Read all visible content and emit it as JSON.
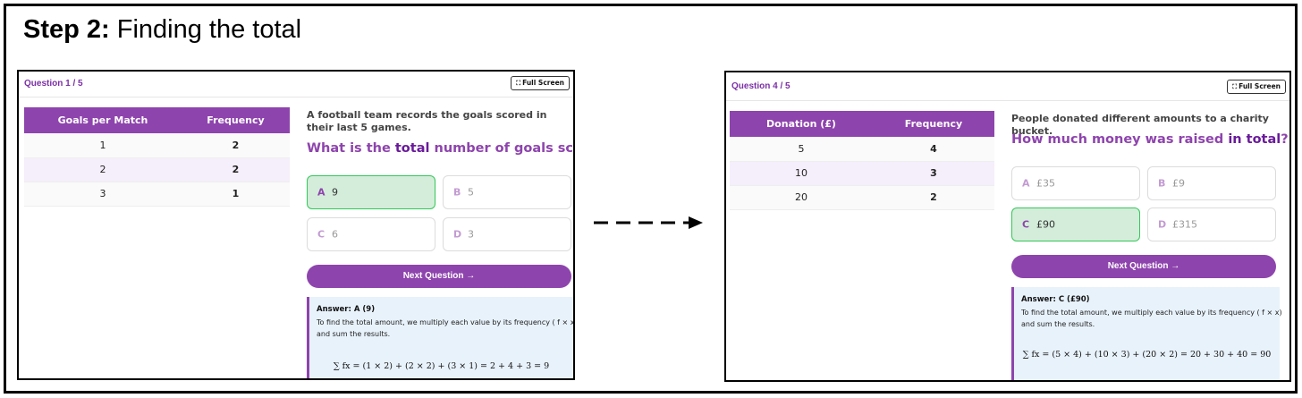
{
  "step": {
    "label": "Step 2:",
    "title": "Finding the total"
  },
  "fullscreen_label": "Full Screen",
  "next_label": "Next Question →",
  "panels": [
    {
      "counter": "Question 1 / 5",
      "columns": [
        "Goals per Match",
        "Frequency"
      ],
      "rows": [
        [
          "1",
          "2"
        ],
        [
          "2",
          "2"
        ],
        [
          "3",
          "1"
        ]
      ],
      "context": "A football team records the goals scored in their last 5 games.",
      "question_pre": "What is the ",
      "question_emph": "total",
      "question_post": " number of goals scored?",
      "options": [
        {
          "letter": "A",
          "text": "9",
          "state": "correct"
        },
        {
          "letter": "B",
          "text": "5",
          "state": "default"
        },
        {
          "letter": "C",
          "text": "6",
          "state": "default"
        },
        {
          "letter": "D",
          "text": "3",
          "state": "default"
        }
      ],
      "answer_title": "Answer: A (9)",
      "answer_explanation": "To find the total amount, we multiply each value by its frequency ( f × x) and sum the results.",
      "formula": "∑ fx = (1 × 2) + (2 × 2) + (3 × 1) = 2 + 4 + 3 = 9"
    },
    {
      "counter": "Question 4 / 5",
      "columns": [
        "Donation (£)",
        "Frequency"
      ],
      "rows": [
        [
          "5",
          "4"
        ],
        [
          "10",
          "3"
        ],
        [
          "20",
          "2"
        ]
      ],
      "context": "People donated different amounts to a charity bucket.",
      "question_pre": "How much money was raised ",
      "question_emph": "in total",
      "question_post": "?",
      "options": [
        {
          "letter": "A",
          "text": "£35",
          "state": "default"
        },
        {
          "letter": "B",
          "text": "£9",
          "state": "default"
        },
        {
          "letter": "C",
          "text": "£90",
          "state": "correct"
        },
        {
          "letter": "D",
          "text": "£315",
          "state": "default"
        }
      ],
      "answer_title": "Answer: C (£90)",
      "answer_explanation": "To find the total amount, we multiply each value by its frequency ( f × x) and sum the results.",
      "formula": "∑ fx = (5 × 4) + (10 × 3) + (20 × 2) = 20 + 30 + 40 = 90"
    }
  ],
  "colors": {
    "accent": "#8e44ad",
    "correct_bg": "#d4edda",
    "correct_border": "#34c759",
    "answer_bg": "#e8f2fb"
  }
}
